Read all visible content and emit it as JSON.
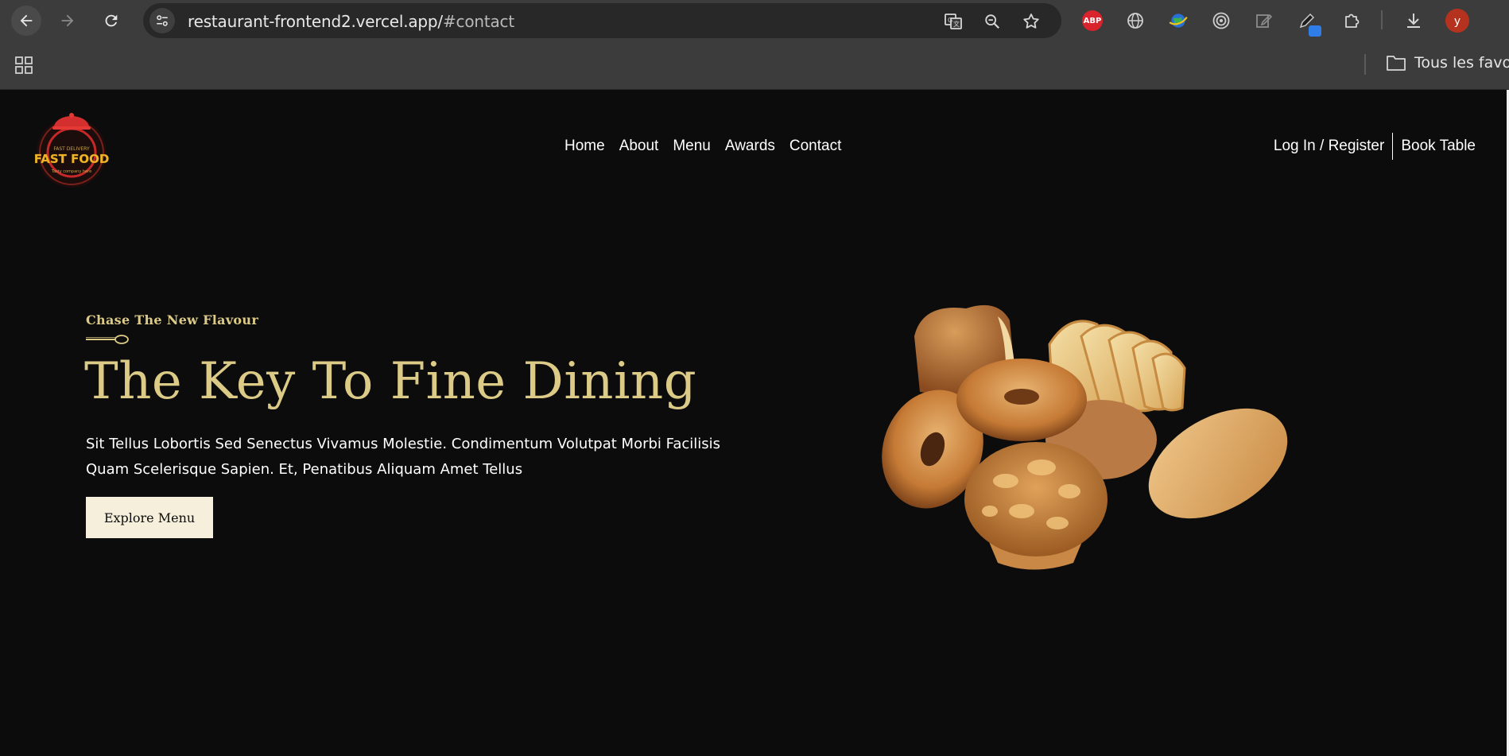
{
  "browser": {
    "url_host": "restaurant-frontend2.vercel.app/",
    "url_path": "#contact",
    "extension_abp_label": "ABP",
    "profile_initial": "y",
    "bookmarks_folder": "Tous les favoris"
  },
  "site": {
    "logo_text": "FAST FOOD",
    "nav": {
      "home": "Home",
      "about": "About",
      "menu": "Menu",
      "awards": "Awards",
      "contact": "Contact"
    },
    "login": "Log In / Register",
    "book_table": "Book Table"
  },
  "hero": {
    "subtitle": "Chase The New Flavour",
    "title": "The Key To Fine Dining",
    "description": "Sit Tellus Lobortis Sed Senectus Vivamus Molestie. Condimentum Volutpat Morbi Facilisis Quam Scelerisque Sapien. Et, Penatibus Aliquam Amet Tellus",
    "cta": "Explore Menu"
  },
  "colors": {
    "background": "#0c0c0c",
    "gold": "#dcca87",
    "cream_button": "#f5efdb",
    "browser_chrome": "#3c3c3c"
  },
  "icons": [
    "back-icon",
    "forward-icon",
    "reload-icon",
    "site-settings-icon",
    "translate-icon",
    "zoom-icon",
    "star-icon",
    "globe-icon",
    "earth-icon",
    "target-icon",
    "edit-icon",
    "pen-icon",
    "puzzle-icon",
    "download-icon",
    "apps-grid-icon",
    "folder-icon"
  ]
}
